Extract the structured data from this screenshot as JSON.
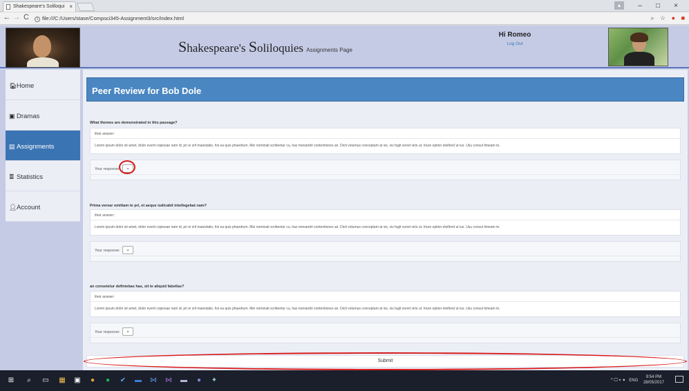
{
  "browser": {
    "tab_title": "Shakespeare's Soliloqui",
    "tab_close": "×",
    "url": "file:///C:/Users/stase/Compsci345-Assignment3/src/index.html",
    "nav_back": "←",
    "nav_forward": "→",
    "nav_reload": "C",
    "info_glyph": "i",
    "zoom_icon": "⌕",
    "star_icon": "☆",
    "ext_icon": "●",
    "menu_icon": "■",
    "minimize": "–",
    "maximize": "□",
    "close": "×"
  },
  "header": {
    "title_s1": "S",
    "title_w1": "hakespeare's ",
    "title_s2": "S",
    "title_w2": "oliloquies",
    "subtitle": "Assignments Page",
    "greeting": "Hi Romeo",
    "logout": "Log Out"
  },
  "sidebar": {
    "items": [
      {
        "label": "Home",
        "icon": "🏠︎"
      },
      {
        "label": "Dramas",
        "icon": "▣"
      },
      {
        "label": "Assignments",
        "icon": "▤"
      },
      {
        "label": "Statistics",
        "icon": "≣"
      },
      {
        "label": "Account",
        "icon": "👤︎"
      }
    ],
    "active": "Assignments"
  },
  "main": {
    "heading": "Peer Review for Bob Dole",
    "answer_label": "their answer:",
    "response_label": "Your response:",
    "select_glyph": "⌄",
    "questions": [
      {
        "title": "What themes are demonstrated in this passage?",
        "answer": "Lorem ipsum dolor sit amet, dolor everti copiosae nam id, pri ei zril maiestatis, his ea quis phaedrum. Mei nominati scribentur cu, has menandri contentiones an. Dicit volumus conceptam at vis, vis fugit sonet viris ut. Iriure option eleifend ut ius. Usu consul timeam te."
      },
      {
        "title": "Prima verear omittam te pri, et aeque iudicabit intellegebat nam?",
        "answer": "Lorem ipsum dolor sit amet, dolor everti copiosae nam id, pri ei zril maiestatis, his ea quis phaedrum. Mei nominati scribentur cu, has menandri contentiones an. Dicit volumus conceptam at vis, vis fugit sonet viris ut. Iriure option eleifend ut ius. Usu consul timeam te."
      },
      {
        "title": "an consetetur definiebas has, sit te aliquid fabellas?",
        "answer": "Lorem ipsum dolor sit amet, dolor everti copiosae nam id, pri ei zril maiestatis, his ea quis phaedrum. Mei nominati scribentur cu, has menandri contentiones an. Dicit volumus conceptam at vis, vis fugit sonet viris ut. Iriure option eleifend ut ius. Usu consul timeam te."
      }
    ],
    "submit": "Submit"
  },
  "taskbar": {
    "start_icon": "⊞",
    "search_icon": "⌕",
    "taskview_icon": "▭",
    "apps": [
      "▦",
      "▣",
      "●",
      "●",
      "✔",
      "▬",
      "⋈",
      "⋈",
      "▬",
      "●",
      "✦"
    ],
    "tray_icons": "^ 🖵 🔈︎ ●",
    "lang": "ENG",
    "time": "9:54 PM",
    "date": "28/05/2017"
  },
  "colors": {
    "accent": "#3b74b3",
    "annotation": "#d81a1a"
  }
}
